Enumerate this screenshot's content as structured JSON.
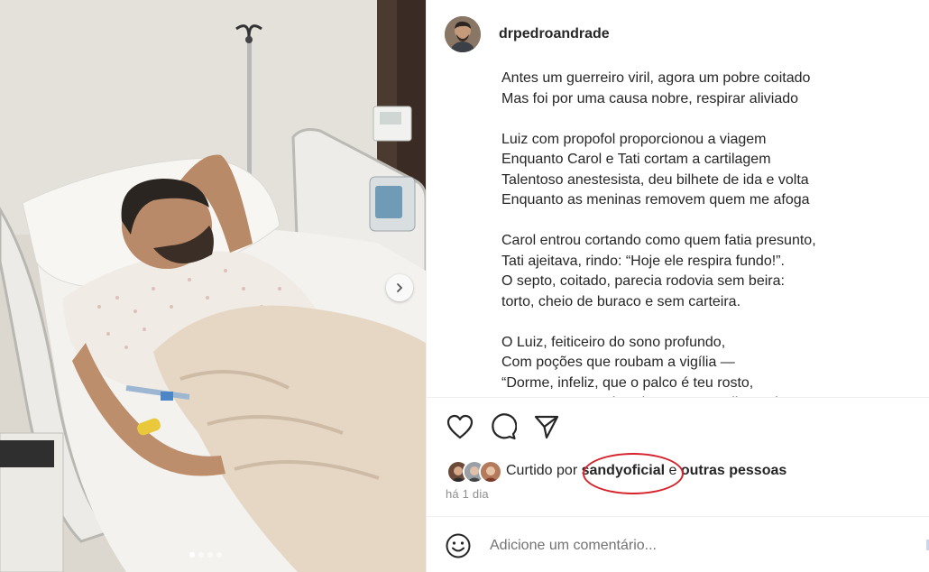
{
  "post": {
    "username": "drpedroandrade",
    "avatar_icon": "profile-avatar",
    "caption_lines": [
      "Antes um guerreiro viril, agora um pobre coitado",
      "Mas foi por uma causa nobre, respirar aliviado",
      "",
      "Luiz com propofol proporcionou a viagem",
      "Enquanto Carol e Tati cortam a cartilagem",
      "Talentoso anestesista, deu bilhete de ida e volta",
      "Enquanto as meninas removem quem me afoga",
      "",
      "Carol entrou cortando como quem fatia presunto,",
      "Tati ajeitava, rindo: “Hoje ele respira fundo!”.",
      "O septo, coitado, parecia rodovia sem beira:",
      "torto, cheio de buraco e sem carteira.",
      "",
      "O Luiz, feiticeiro do sono profundo,",
      "Com poções que roubam a vigília —",
      "“Dorme, infeliz, que o palco é teu rosto,",
      "Enquanto teu nariz vai ser um caso ilustrado.”"
    ]
  },
  "media": {
    "slide_count": 4,
    "active_slide": 0,
    "next_icon": "chevron-right-icon"
  },
  "actions": {
    "like_icon": "heart-icon",
    "comment_icon": "comment-bubble-icon",
    "share_icon": "paper-plane-icon"
  },
  "likes": {
    "prefix": "Curtido por ",
    "user": "sandyoficial",
    "middle": " e ",
    "others": "outras pessoas"
  },
  "time_ago": "há 1 dia",
  "comment_box": {
    "placeholder": "Adicione um comentário...",
    "emoji_icon": "smiley-icon"
  },
  "colors": {
    "highlight_ring": "#d6222a",
    "muted_text": "#8e8e8e",
    "divider": "#efefef"
  }
}
